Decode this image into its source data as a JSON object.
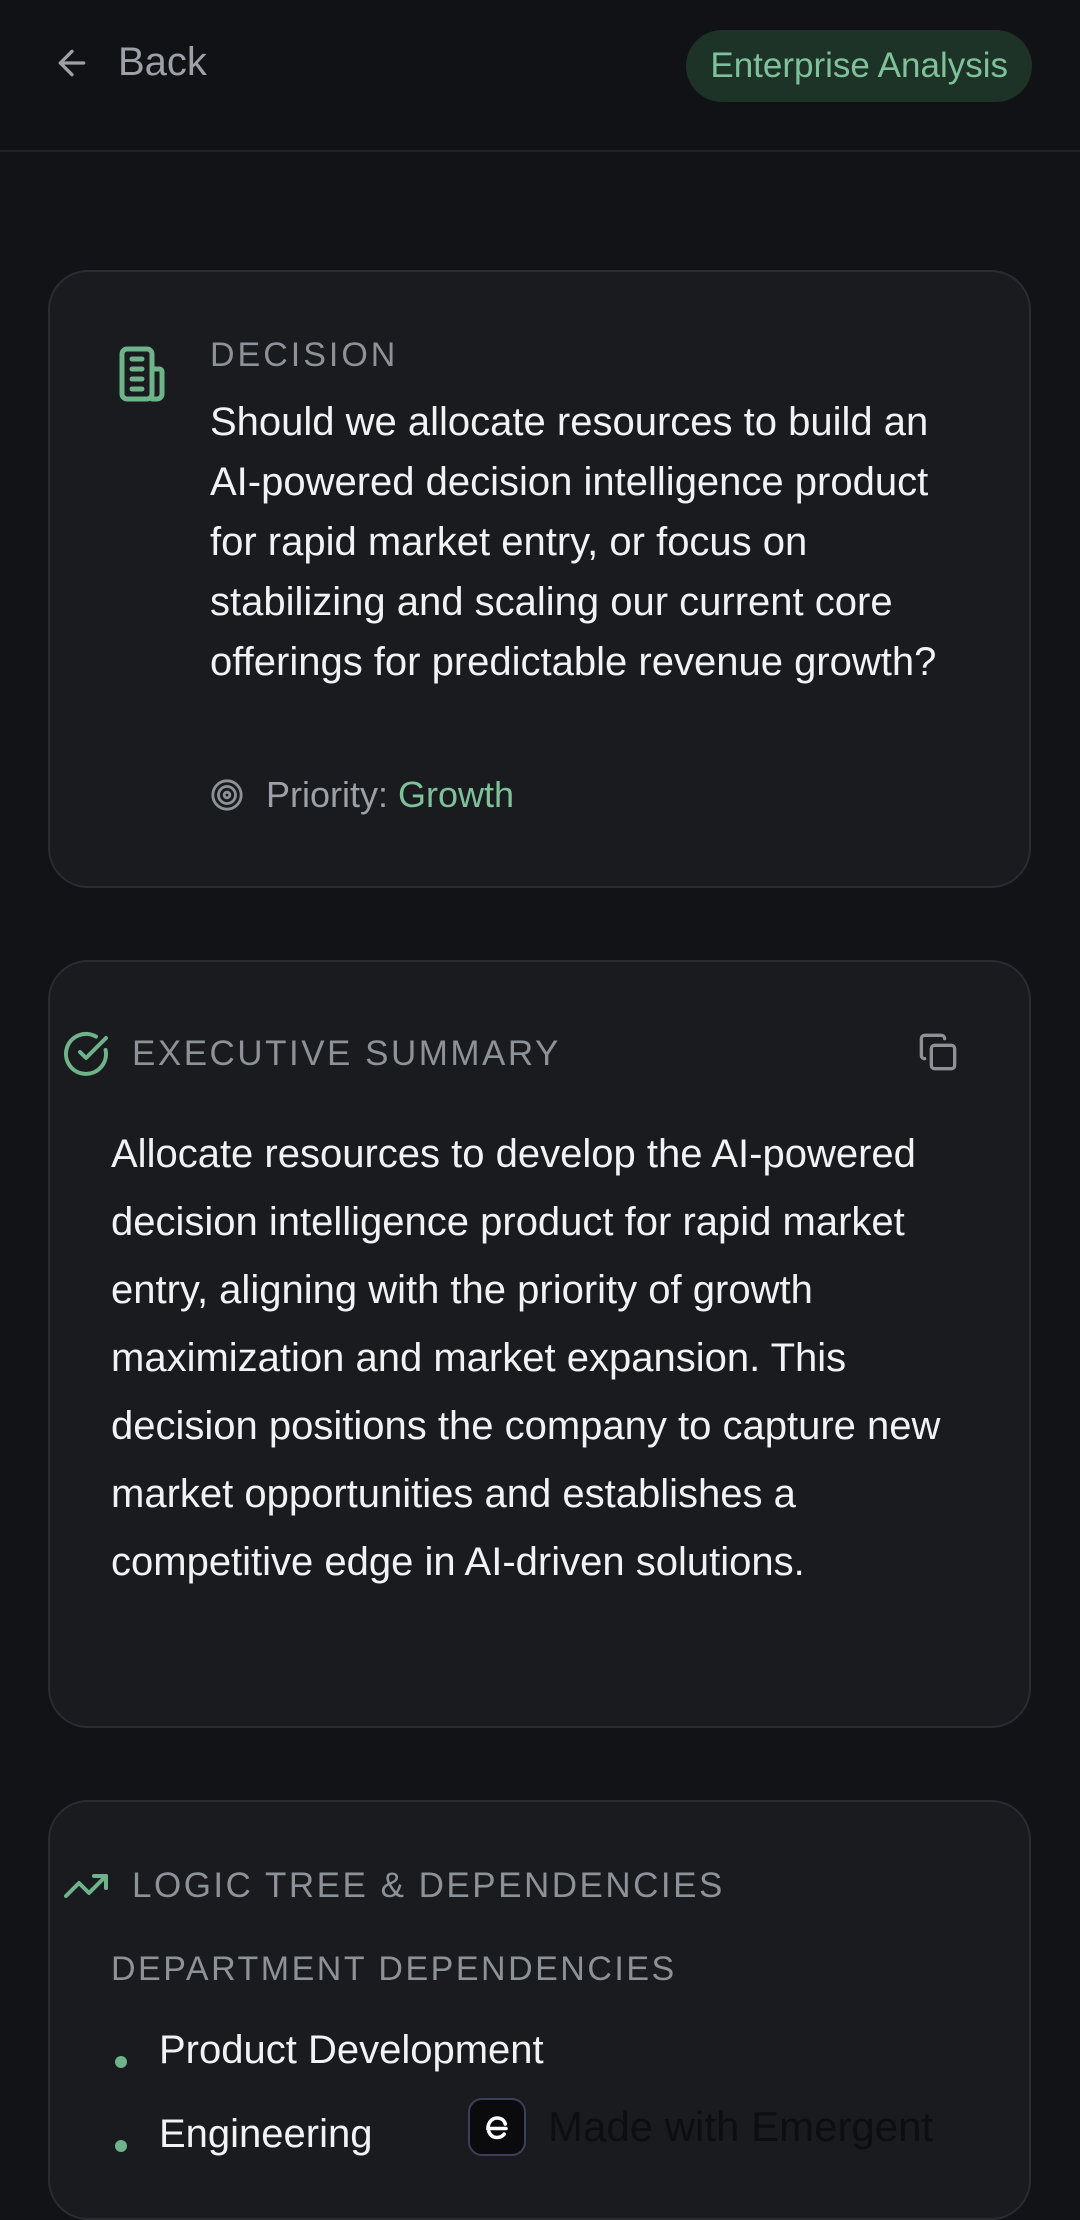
{
  "header": {
    "back_label": "Back",
    "badge_label": "Enterprise Analysis"
  },
  "decision_card": {
    "section_label": "DECISION",
    "question": "Should we allocate resources to build an AI-powered decision intelligence product for rapid market entry, or focus on stabilizing and scaling our current core offerings for predictable revenue growth?",
    "priority_label": "Priority:",
    "priority_value": "Growth"
  },
  "summary_card": {
    "section_label": "EXECUTIVE SUMMARY",
    "text": "Allocate resources to develop the AI-powered decision intelligence product for rapid market entry, aligning with the priority of growth maximization and market expansion. This decision positions the company to capture new market opportunities and establishes a competitive edge in AI-driven solutions."
  },
  "logic_card": {
    "section_label": "LOGIC TREE & DEPENDENCIES",
    "dependencies_label": "DEPARTMENT DEPENDENCIES",
    "dependencies": [
      "Product Development",
      "Engineering"
    ]
  },
  "watermark": {
    "label": "Made with Emergent"
  },
  "icons": {
    "back": "arrow-left-icon",
    "decision": "document-icon",
    "priority": "target-icon",
    "summary": "check-circle-icon",
    "copy": "copy-icon",
    "logic": "trending-up-icon",
    "watermark_logo": "emergent-logo-icon"
  },
  "colors": {
    "background": "#121316",
    "card": "#1a1b1f",
    "accent": "#7fc29a",
    "badge_bg": "#1e3328",
    "muted_text": "#8d9198",
    "text": "#f1f2f4"
  }
}
